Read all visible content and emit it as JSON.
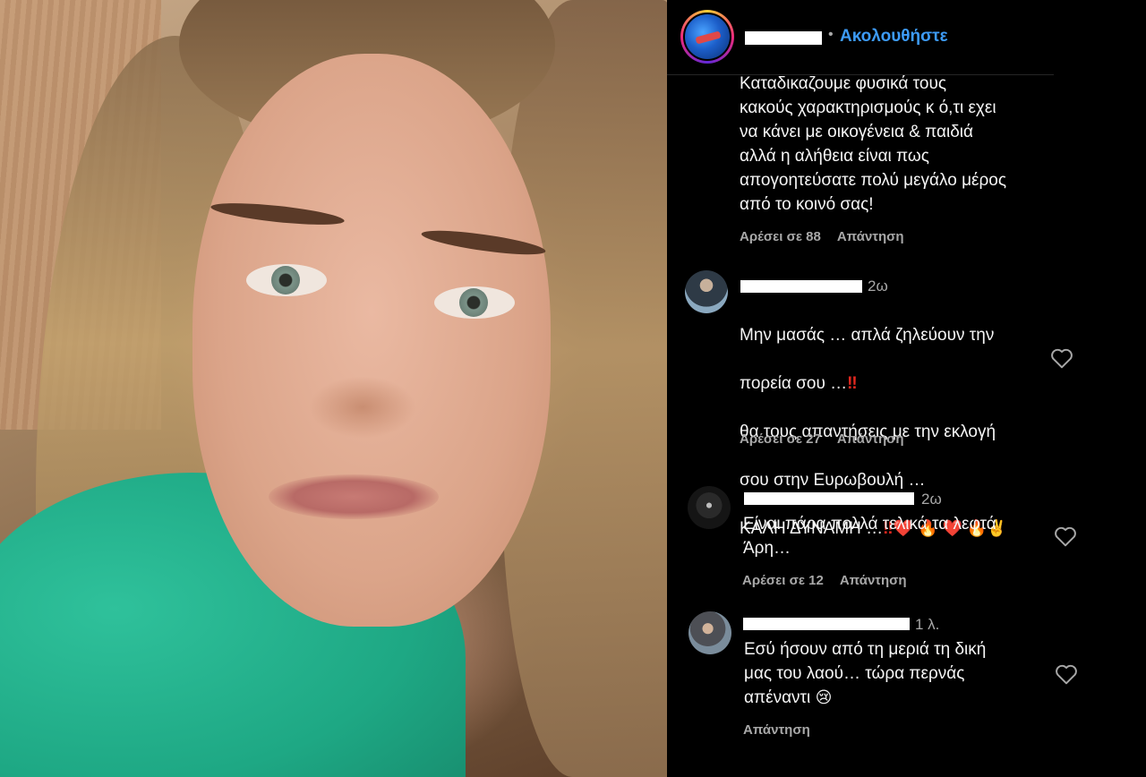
{
  "header": {
    "separator": "•",
    "follow_label": "Ακολουθήστε"
  },
  "caption": {
    "text": "Καταδικαζουμε φυσικά τους\nκακούς χαρακτηρισμούς κ ό,τι εχει\nνα κάνει με οικογένεια & παιδιά\nαλλά η αλήθεια είναι πως\nαπογοητεύσατε πολύ μεγάλο μέρος\nαπό το κοινό σας!",
    "likes": "Αρέσει σε 88",
    "reply": "Απάντηση"
  },
  "comments": [
    {
      "time": "2ω",
      "line1": "Μην μασάς … απλά ζηλεύουν την",
      "line2": "πορεία σου …",
      "line3": "θα τους απαντήσεις με την εκλογή",
      "line4": "σου στην Ευρωβουλή …",
      "line5": "ΚΑΛΗ ΔΥΝΑΜΗ …",
      "bang": "‼",
      "emoji_tail": "❤️ 🔥 ❤️ 🔥✌️",
      "likes": "Αρέσει σε 27",
      "reply": "Απάντηση"
    },
    {
      "time": "2ω",
      "text": "Είναι πάρα πολλά τελικά τα λεφτά\nΆρη…",
      "likes": "Αρέσει σε 12",
      "reply": "Απάντηση"
    },
    {
      "time": "1 λ.",
      "text": "Εσύ ήσουν από τη μεριά τη δική\nμας του λαού… τώρα περνάς\nαπέναντι",
      "emoji": "😢",
      "reply": "Απάντηση"
    }
  ],
  "icons": {
    "heart": "heart-outline-icon",
    "avatar": "profile-avatar"
  },
  "colors": {
    "follow": "#3d9bf7",
    "text": "#f5f5f5",
    "muted": "#a8a8a8",
    "background": "#000000"
  }
}
